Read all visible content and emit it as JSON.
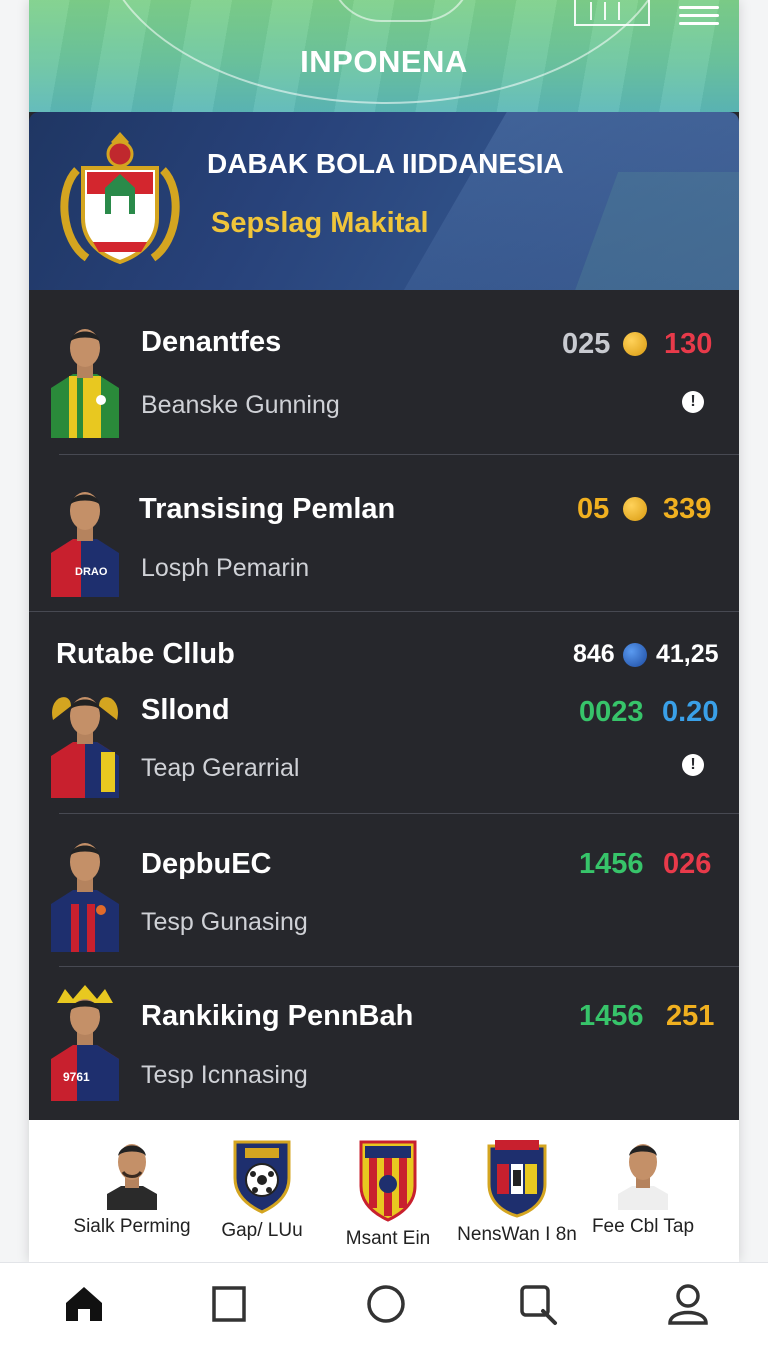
{
  "header": {
    "title": "INPONENA",
    "menu_icon": "hamburger-menu-icon"
  },
  "banner": {
    "title": "DABAK BOLA IIDDANESIA",
    "subtitle": "Sepslag Makital",
    "crest_icon": "federation-crest-icon"
  },
  "players": [
    {
      "name": "Denantfes",
      "sub": "Beanske Gunning",
      "stat1": "025",
      "stat1_color": "#c8cad0",
      "dot_color": "#f0b020",
      "stat2": "130",
      "stat2_color": "#e83a4a",
      "info": "!"
    },
    {
      "name": "Transising Pemlan",
      "sub": "Losph Pemarin",
      "stat1": "05",
      "stat1_color": "#f0b020",
      "dot_color": "#f0b020",
      "stat2": "339",
      "stat2_color": "#f0b020",
      "jersey_text": "DRAO"
    }
  ],
  "section": {
    "title": "Rutabe Cllub",
    "stat1": "846",
    "dot_color": "#2a6ad0",
    "stat2": "41,25"
  },
  "club_rows": [
    {
      "name": "Sllond",
      "sub": "Teap Gerarrial",
      "stat1": "0023",
      "stat1_color": "#37c46a",
      "stat2": "0.20",
      "stat2_color": "#3aa0e8",
      "info": "!"
    },
    {
      "name": "DepbuEC",
      "sub": "Tesp Gunasing",
      "stat1": "1456",
      "stat1_color": "#37c46a",
      "stat2": "026",
      "stat2_color": "#e83a4a"
    },
    {
      "name": "Rankiking PennBah",
      "sub": "Tesp Icnnasing",
      "stat1": "1456",
      "stat1_color": "#37c46a",
      "stat2": "251",
      "stat2_color": "#f0b020",
      "jersey_text": "9761"
    }
  ],
  "clubs": [
    {
      "label": "Sialk Perming",
      "icon": "player-avatar-icon"
    },
    {
      "label": "Gap/ LUu",
      "icon": "club-shield-ball-icon"
    },
    {
      "label": "Msant Ein",
      "icon": "club-crest-striped-icon"
    },
    {
      "label": "NensWan I 8n",
      "icon": "club-crest-tricolor-icon"
    },
    {
      "label": "Fee Cbl Tap",
      "icon": "player-avatar-icon"
    }
  ],
  "bottom_nav": [
    "home-icon",
    "square-icon",
    "circle-icon",
    "search-icon",
    "profile-icon"
  ]
}
